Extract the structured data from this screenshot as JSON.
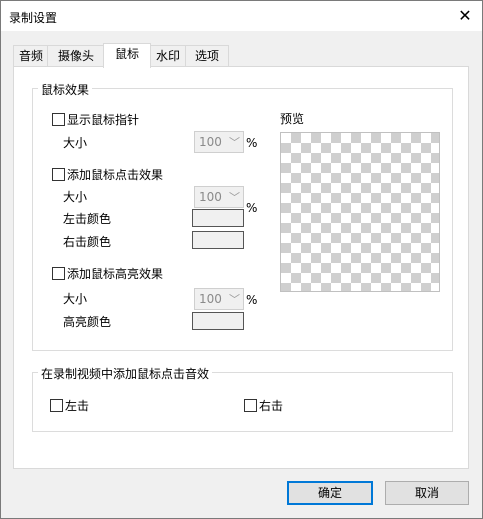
{
  "window": {
    "title": "录制设置",
    "close_glyph": "✕"
  },
  "tabs": [
    {
      "label": "音频"
    },
    {
      "label": "摄像头"
    },
    {
      "label": "鼠标"
    },
    {
      "label": "水印"
    },
    {
      "label": "选项"
    }
  ],
  "active_tab": "鼠标",
  "mouse_group": {
    "label": "鼠标效果",
    "show_pointer": {
      "label": "显示鼠标指针",
      "checked": false,
      "size_label": "大小",
      "size_value": "100",
      "unit": "%"
    },
    "click_effect": {
      "label": "添加鼠标点击效果",
      "checked": false,
      "size_label": "大小",
      "size_value": "100",
      "unit": "%",
      "left_color_label": "左击颜色",
      "right_color_label": "右击颜色"
    },
    "highlight_effect": {
      "label": "添加鼠标高亮效果",
      "checked": false,
      "size_label": "大小",
      "size_value": "100",
      "unit": "%",
      "highlight_color_label": "高亮颜色"
    },
    "preview_label": "预览"
  },
  "sound_group": {
    "label": "在录制视频中添加鼠标点击音效",
    "left": {
      "label": "左击",
      "checked": false
    },
    "right": {
      "label": "右击",
      "checked": false
    }
  },
  "buttons": {
    "ok": "确定",
    "cancel": "取消"
  },
  "colors": {
    "accent": "#0078d7",
    "dialog_bg": "#f0f0f0",
    "checker": "#cfcfcf"
  },
  "icons": {
    "close": "close-icon",
    "dropdown": "chevron-down-icon"
  }
}
